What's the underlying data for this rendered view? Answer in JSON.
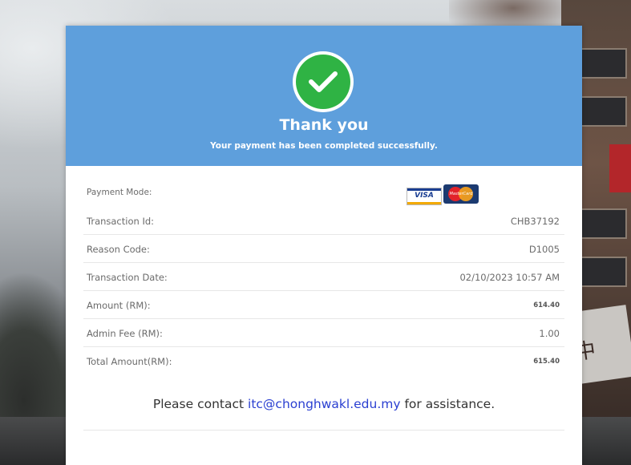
{
  "header": {
    "title": "Thank you",
    "subtitle": "Your payment has been completed successfully.",
    "icon": "check-circle-icon"
  },
  "payment_mode": {
    "label": "Payment Mode:",
    "logos": [
      "VISA",
      "MasterCard"
    ]
  },
  "rows": [
    {
      "label": "Transaction Id:",
      "value": "CHB37192"
    },
    {
      "label": "Reason Code:",
      "value": "D1005"
    },
    {
      "label": "Transaction Date:",
      "value": "02/10/2023 10:57 AM"
    },
    {
      "label": "Amount (RM):",
      "value": "614.40"
    },
    {
      "label": "Admin Fee (RM):",
      "value": "1.00"
    },
    {
      "label": "Total Amount(RM):",
      "value": "615.40"
    }
  ],
  "contact": {
    "prefix": "Please contact ",
    "email": "itc@chonghwakl.edu.my",
    "suffix": " for assistance."
  },
  "colors": {
    "header_bg": "#5e9fdc",
    "success_green": "#2fb344",
    "link_blue": "#2a3fd1"
  }
}
